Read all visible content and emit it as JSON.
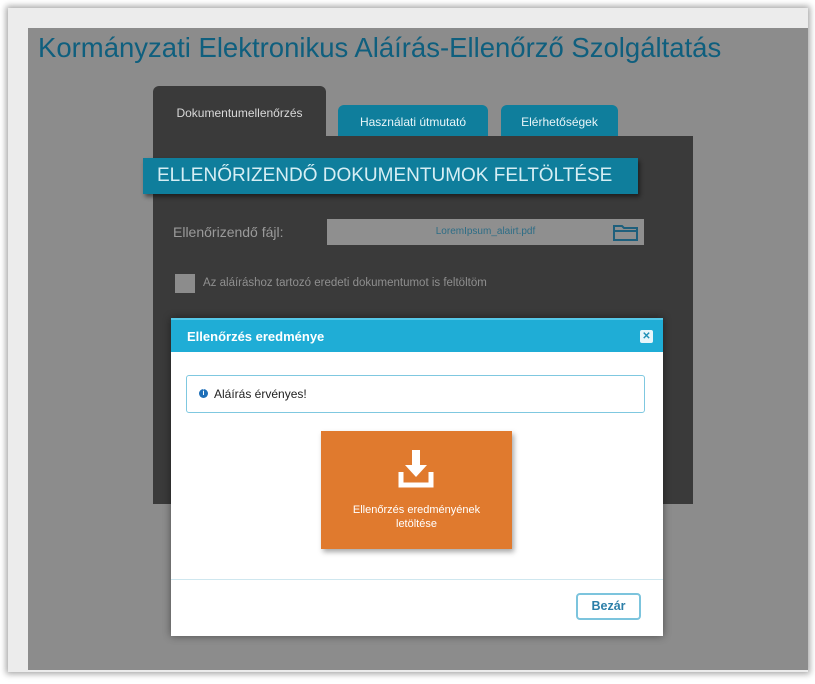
{
  "app": {
    "title": "Kormányzati Elektronikus Aláírás-Ellenőrző Szolgáltatás"
  },
  "tabs": [
    {
      "label": "Dokumentumellenőrzés",
      "active": true
    },
    {
      "label": "Használati útmutató",
      "active": false
    },
    {
      "label": "Elérhetőségek",
      "active": false
    }
  ],
  "upload": {
    "section_title": "ELLENŐRIZENDŐ DOKUMENTUMOK FELTÖLTÉSE",
    "file_label": "Ellenőrizendő fájl:",
    "file_value": "LoremIpsum_alairt.pdf",
    "folder_icon": "folder-open-icon",
    "checkbox_label": "Az aláíráshoz tartozó eredeti dokumentumot is feltöltöm",
    "checkbox_checked": false
  },
  "modal": {
    "title": "Ellenőrzés eredménye",
    "close_icon": "close-icon",
    "alert_icon": "info-icon",
    "alert_text": "Aláírás érvényes!",
    "download_icon": "download-icon",
    "download_label": "Ellenőrzés eredményének letöltése",
    "close_button_label": "Bezár"
  },
  "colors": {
    "title": "#0f5f7e",
    "tab_teal": "#0f7e9c",
    "modal_header": "#1fadd6",
    "download_orange": "#e07a2e",
    "overlay_gray": "#8c8c8c"
  }
}
